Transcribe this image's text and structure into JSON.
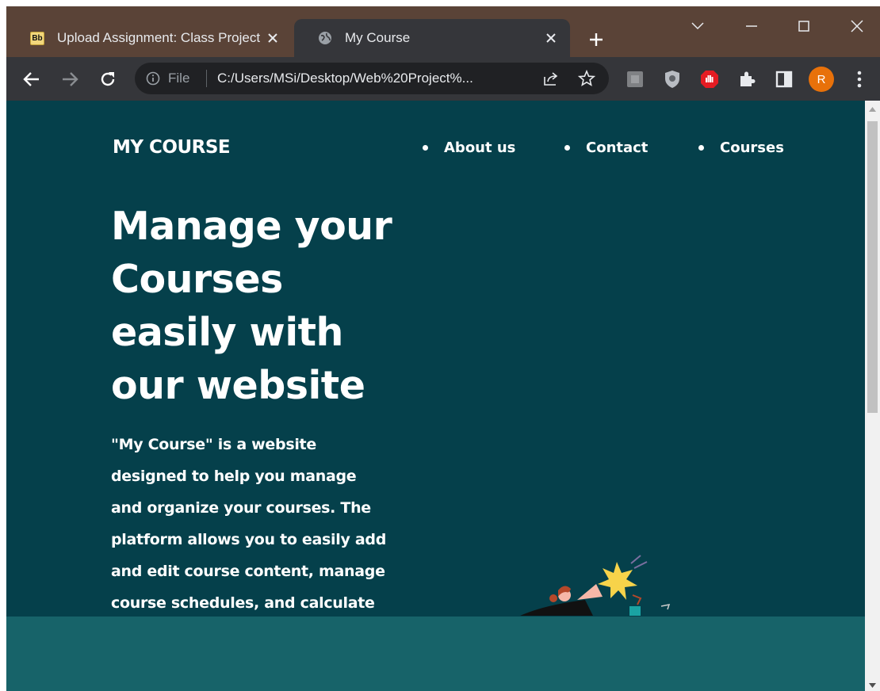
{
  "browser": {
    "tabs": [
      {
        "title": "Upload Assignment: Class Project",
        "active": false
      },
      {
        "title": "My Course",
        "active": true
      }
    ],
    "address": {
      "scheme_label": "File",
      "url": "C:/Users/MSi/Desktop/Web%20Project%..."
    },
    "profile_initial": "R",
    "colors": {
      "frame": "#5a4337",
      "toolbar": "#35363a",
      "avatar": "#e8710a"
    }
  },
  "page": {
    "brand": "MY COURSE",
    "nav": [
      {
        "label": "About us"
      },
      {
        "label": "Contact"
      },
      {
        "label": "Courses"
      }
    ],
    "hero": {
      "title_lines": [
        "Manage your",
        "Courses",
        "easily with",
        "our website"
      ],
      "description_lines": [
        "\"My Course\" is a website",
        "designed to help you manage",
        "and organize your courses. The",
        "platform allows you to easily add",
        "and edit course content, manage",
        "course schedules, and calculate"
      ]
    },
    "colors": {
      "background": "#05404b",
      "band": "#176369",
      "text": "#ffffff"
    }
  }
}
